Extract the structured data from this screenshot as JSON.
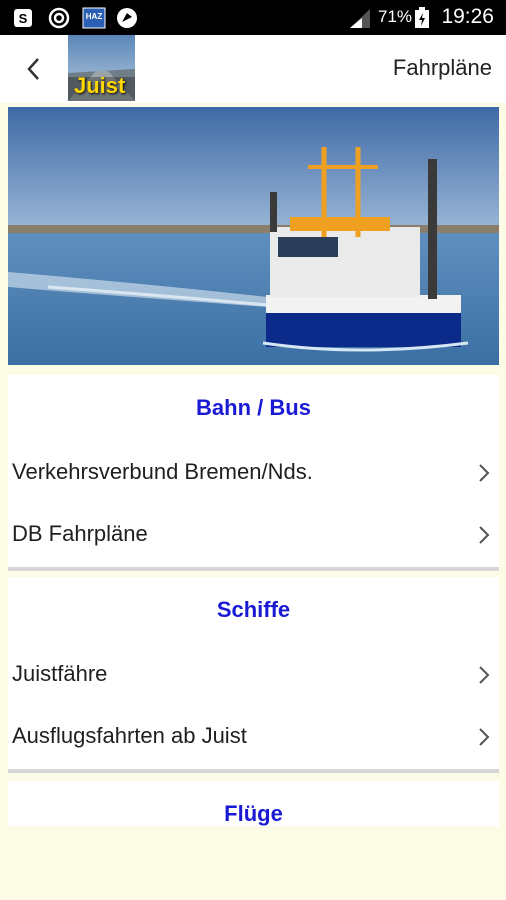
{
  "status_bar": {
    "battery_percent": "71%",
    "time": "19:26",
    "icons": [
      "notification-s-icon",
      "sync-icon",
      "haz-app-icon",
      "browser-icon",
      "signal-icon",
      "battery-icon"
    ]
  },
  "app_bar": {
    "logo_text": "Juist",
    "title": "Fahrpläne",
    "back_icon": "chevron-left-icon"
  },
  "hero": {
    "description": "ferry photo"
  },
  "sections": [
    {
      "title": "Bahn / Bus",
      "items": [
        {
          "label": "Verkehrsverbund Bremen/Nds."
        },
        {
          "label": "DB Fahrpläne"
        }
      ]
    },
    {
      "title": "Schiffe",
      "items": [
        {
          "label": "Juistfähre"
        },
        {
          "label": "Ausflugsfahrten ab Juist"
        }
      ]
    },
    {
      "title": "Flüge",
      "items": []
    }
  ],
  "colors": {
    "section_title": "#1a1ad4",
    "background": "#fbfbe6"
  }
}
